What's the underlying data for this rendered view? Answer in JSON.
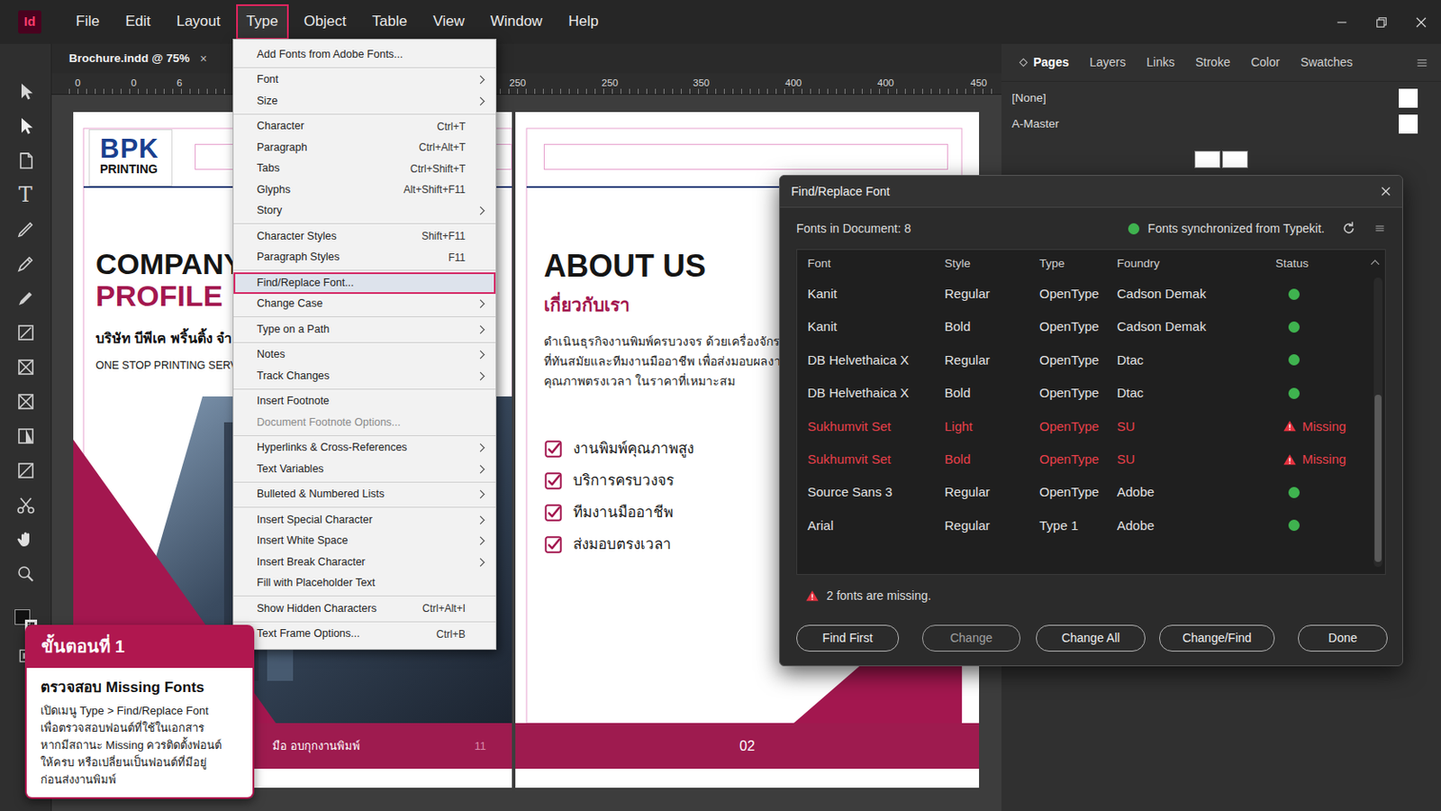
{
  "app": {
    "logo": "Id"
  },
  "menubar": [
    {
      "label": "File",
      "selected": false
    },
    {
      "label": "Edit",
      "selected": false
    },
    {
      "label": "Layout",
      "selected": false
    },
    {
      "label": "Type",
      "selected": true
    },
    {
      "label": "Object",
      "selected": false
    },
    {
      "label": "Table",
      "selected": false
    },
    {
      "label": "View",
      "selected": false
    },
    {
      "label": "Window",
      "selected": false
    },
    {
      "label": "Help",
      "selected": false
    }
  ],
  "document_tab": {
    "title": "Brochure.indd @ 75%",
    "close": "×"
  },
  "ruler": [
    "0",
    "0",
    "6",
    "250",
    "250",
    "350",
    "400",
    "400",
    "450"
  ],
  "toolbar": {
    "type_tool": "T"
  },
  "left_page": {
    "logo_big": "BPK",
    "logo_small": "PRINTING",
    "title_1": "COMPANY",
    "title_2": "PROFILE",
    "subtitle": "บริษัท บีพีเค พริ้นติ้ง จำ",
    "tagline": "ONE STOP PRINTING SERVI",
    "footer": "มือ อบกุกงานพิมพ์",
    "page_number": "11"
  },
  "right_page": {
    "title": "ABOUT US",
    "subtitle": "เกี่ยวกับเรา",
    "paragraph": [
      "ดำเนินธุรกิจงานพิมพ์ครบวงจร ด้วยเครื่องจักร",
      "ที่ทันสมัยและทีมงานมืออาชีพ เพื่อส่งมอบผลงาน",
      "คุณภาพตรงเวลา ในราคาที่เหมาะสม"
    ],
    "checklist": [
      {
        "label": "งานพิมพ์คุณภาพสูง",
        "checked": true
      },
      {
        "label": "บริการครบวงจร",
        "checked": true
      },
      {
        "label": "ทีมงานมืออาชีพ",
        "checked": true
      },
      {
        "label": "ส่งมอบตรงเวลา",
        "checked": true
      }
    ],
    "page_number": "02"
  },
  "type_menu": [
    {
      "kind": "item",
      "label": "Add Fonts from Adobe Fonts...",
      "submenu": false,
      "disabled": false,
      "selected": false
    },
    {
      "kind": "separator"
    },
    {
      "kind": "item",
      "label": "Font",
      "submenu": true,
      "disabled": false,
      "selected": false
    },
    {
      "kind": "item",
      "label": "Size",
      "submenu": true,
      "disabled": false,
      "selected": false
    },
    {
      "kind": "separator"
    },
    {
      "kind": "item",
      "label": "Character",
      "shortcut": "Ctrl+T",
      "submenu": false,
      "disabled": false,
      "selected": false
    },
    {
      "kind": "item",
      "label": "Paragraph",
      "shortcut": "Ctrl+Alt+T",
      "submenu": false,
      "disabled": false,
      "selected": false
    },
    {
      "kind": "item",
      "label": "Tabs",
      "shortcut": "Ctrl+Shift+T",
      "submenu": false,
      "disabled": false,
      "selected": false
    },
    {
      "kind": "item",
      "label": "Glyphs",
      "shortcut": "Alt+Shift+F11",
      "submenu": false,
      "disabled": false,
      "selected": false
    },
    {
      "kind": "item",
      "label": "Story",
      "submenu": true,
      "disabled": false,
      "selected": false
    },
    {
      "kind": "separator"
    },
    {
      "kind": "item",
      "label": "Character Styles",
      "shortcut": "Shift+F11",
      "submenu": false,
      "disabled": false,
      "selected": false
    },
    {
      "kind": "item",
      "label": "Paragraph Styles",
      "shortcut": "F11",
      "submenu": false,
      "disabled": false,
      "selected": false
    },
    {
      "kind": "separator"
    },
    {
      "kind": "item",
      "label": "Find/Replace Font...",
      "submenu": false,
      "disabled": false,
      "selected": true
    },
    {
      "kind": "item",
      "label": "Change Case",
      "submenu": true,
      "disabled": false,
      "selected": false
    },
    {
      "kind": "separator"
    },
    {
      "kind": "item",
      "label": "Type on a Path",
      "submenu": true,
      "disabled": false,
      "selected": false
    },
    {
      "kind": "separator"
    },
    {
      "kind": "item",
      "label": "Notes",
      "submenu": true,
      "disabled": false,
      "selected": false
    },
    {
      "kind": "item",
      "label": "Track Changes",
      "submenu": true,
      "disabled": false,
      "selected": false
    },
    {
      "kind": "separator"
    },
    {
      "kind": "item",
      "label": "Insert Footnote",
      "submenu": false,
      "disabled": false,
      "selected": false
    },
    {
      "kind": "item",
      "label": "Document Footnote Options...",
      "submenu": false,
      "disabled": true,
      "selected": false
    },
    {
      "kind": "separator"
    },
    {
      "kind": "item",
      "label": "Hyperlinks & Cross-References",
      "submenu": true,
      "disabled": false,
      "selected": false
    },
    {
      "kind": "item",
      "label": "Text Variables",
      "submenu": true,
      "disabled": false,
      "selected": false
    },
    {
      "kind": "separator"
    },
    {
      "kind": "item",
      "label": "Bulleted & Numbered Lists",
      "submenu": true,
      "disabled": false,
      "selected": false
    },
    {
      "kind": "separator"
    },
    {
      "kind": "item",
      "label": "Insert Special Character",
      "submenu": true,
      "disabled": false,
      "selected": false
    },
    {
      "kind": "item",
      "label": "Insert White Space",
      "submenu": true,
      "disabled": false,
      "selected": false
    },
    {
      "kind": "item",
      "label": "Insert Break Character",
      "submenu": true,
      "disabled": false,
      "selected": false
    },
    {
      "kind": "item",
      "label": "Fill with Placeholder Text",
      "submenu": false,
      "disabled": false,
      "selected": false
    },
    {
      "kind": "separator"
    },
    {
      "kind": "item",
      "label": "Show Hidden Characters",
      "shortcut": "Ctrl+Alt+I",
      "submenu": false,
      "disabled": false,
      "selected": false
    },
    {
      "kind": "separator"
    },
    {
      "kind": "item",
      "label": "Text Frame Options...",
      "shortcut": "Ctrl+B",
      "submenu": false,
      "disabled": false,
      "selected": false
    }
  ],
  "panel": {
    "tabs": [
      {
        "label": "Pages",
        "selected": true
      },
      {
        "label": "Layers",
        "selected": false
      },
      {
        "label": "Links",
        "selected": false
      },
      {
        "label": "Stroke",
        "selected": false
      },
      {
        "label": "Color",
        "selected": false
      },
      {
        "label": "Swatches",
        "selected": false
      }
    ],
    "masters": [
      {
        "label": "[None]"
      },
      {
        "label": "A-Master"
      }
    ]
  },
  "dialog": {
    "title": "Find/Replace Font",
    "fonts_count": "Fonts in Document: 8",
    "synced": true,
    "sync_text": "Fonts synchronized from Typekit.",
    "columns": [
      "Font",
      "Style",
      "Type",
      "Foundry",
      "Status"
    ],
    "rows": [
      {
        "font": "Kanit",
        "style": "Regular",
        "type": "OpenType",
        "foundry": "Cadson Demak",
        "kind": "ok"
      },
      {
        "font": "Kanit",
        "style": "Bold",
        "type": "OpenType",
        "foundry": "Cadson Demak",
        "kind": "ok"
      },
      {
        "font": "DB Helvethaica X",
        "style": "Regular",
        "type": "OpenType",
        "foundry": "Dtac",
        "kind": "ok"
      },
      {
        "font": "DB Helvethaica X",
        "style": "Bold",
        "type": "OpenType",
        "foundry": "Dtac",
        "kind": "ok"
      },
      {
        "font": "Sukhumvit Set",
        "style": "Light",
        "type": "OpenType",
        "foundry": "SU",
        "kind": "missing",
        "status": "Missing"
      },
      {
        "font": "Sukhumvit Set",
        "style": "Bold",
        "type": "OpenType",
        "foundry": "SU",
        "kind": "missing",
        "status": "Missing"
      },
      {
        "font": "Source Sans 3",
        "style": "Regular",
        "type": "OpenType",
        "foundry": "Adobe",
        "kind": "ok"
      },
      {
        "font": "Arial",
        "style": "Regular",
        "type": "Type 1",
        "foundry": "Adobe",
        "kind": "ok"
      }
    ],
    "warning": "2 fonts are missing.",
    "buttons": [
      {
        "label": "Find First",
        "disabled": false
      },
      {
        "label": "Change",
        "disabled": true
      },
      {
        "label": "Change All",
        "disabled": false
      },
      {
        "label": "Change/Find",
        "disabled": false
      },
      {
        "label": "Done",
        "disabled": false
      }
    ]
  },
  "callout": {
    "step": "ขั้นตอนที่ 1",
    "title": "ตรวจสอบ Missing Fonts",
    "lines": [
      "เปิดเมนู Type > Find/Replace Font",
      "เพื่อตรวจสอบฟอนต์ที่ใช้ในเอกสาร",
      "หากมีสถานะ Missing ควรติดตั้งฟอนต์",
      "ให้ครบ หรือเปลี่ยนเป็นฟอนต์ที่มีอยู่",
      "ก่อนส่งงานพิมพ์"
    ]
  }
}
